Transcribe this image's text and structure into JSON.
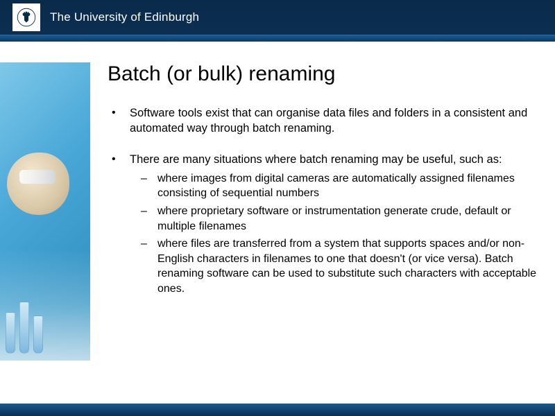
{
  "header": {
    "university_name": "The University of Edinburgh"
  },
  "slide": {
    "title": "Batch (or bulk) renaming",
    "bullets": [
      {
        "text": "Software tools exist that can organise data files and folders in a consistent and automated way through batch renaming."
      },
      {
        "text": "There are many situations where batch renaming may be useful, such as:",
        "sub": [
          "where images from digital cameras are automatically assigned filenames consisting of sequential numbers",
          "where proprietary software or instrumentation generate crude, default or multiple filenames",
          "where files are transferred from a system that supports spaces and/or non-English characters in filenames to one that doesn't (or vice versa). Batch renaming software can be used to substitute such characters with acceptable ones."
        ]
      }
    ]
  }
}
